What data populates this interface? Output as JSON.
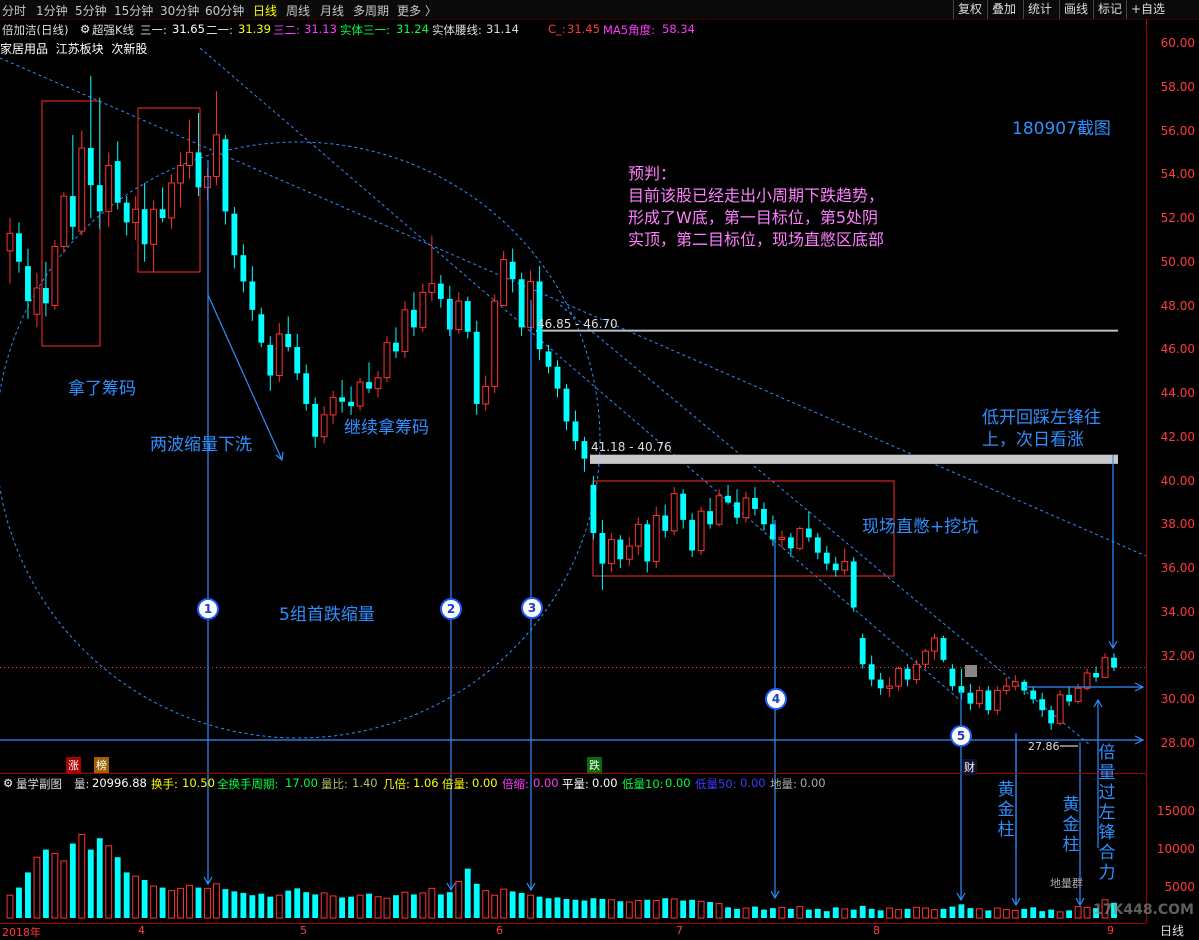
{
  "toolbar": {
    "left_items": [
      "分时",
      "1分钟",
      "5分钟",
      "15分钟",
      "30分钟",
      "60分钟",
      "日线",
      "周线",
      "月线",
      "多周期",
      "更多 〉"
    ],
    "active_item": "日线",
    "right_items": [
      "复权",
      "叠加",
      "统计",
      "画线",
      "标记",
      "+自选"
    ]
  },
  "info": {
    "stock": "倍加洁(日线)",
    "indicator_name": "超强K线",
    "s1_label": "三一:",
    "s1_value": "31.65",
    "s2_label": "二一:",
    "s2_value": "31.39",
    "s3_label": "三二:",
    "s3_value": "31.13",
    "s4_label": "实体三一:",
    "s4_value": "31.24",
    "s5_label": "实体腰线:",
    "s5_value": "31.14",
    "c_label": "C_:",
    "c_value": "31.45",
    "ma_label": "MA5角度:",
    "ma_value": "58.34"
  },
  "tags": [
    "家居用品",
    "江苏板块",
    "次新股"
  ],
  "y_ticks": [
    "60.00",
    "58.00",
    "56.00",
    "54.00",
    "52.00",
    "50.00",
    "48.00",
    "46.00",
    "44.00",
    "42.00",
    "40.00",
    "38.00",
    "36.00",
    "34.00",
    "32.00",
    "30.00",
    "28.00"
  ],
  "vol_ticks": [
    "15000",
    "10000",
    "5000"
  ],
  "x_ticks": [
    "2018年",
    "4",
    "5",
    "6",
    "7",
    "8",
    "9"
  ],
  "x_axis_right": "日线",
  "vol_info": {
    "title": "量学副图",
    "l1": "量:",
    "v1": "20996.88",
    "l2": "换手:",
    "v2": "10.50",
    "l3": "全换手周期:",
    "v3": "17.00",
    "l4": "量比:",
    "v4": "1.40",
    "l5": "几倍:",
    "v5": "1.06",
    "l6": "倍量:",
    "v6": "0.00",
    "l7": "倍缩:",
    "v7": "0.00",
    "l8": "平量:",
    "v8": "0.00",
    "l9": "低量10:",
    "v9": "0.00",
    "l10": "低量50:",
    "v10": "0.00",
    "l11": "地量:",
    "v11": "0.00"
  },
  "annotations": {
    "snapshot": "180907截图",
    "forecast": [
      "预判：",
      "目前该股已经走出小周期下跌趋势，",
      "形成了W底，第一目标位，第5处阴",
      "实顶，第二目标位，现场直憋区底部"
    ],
    "take_chips": "拿了筹码",
    "two_waves": "两波缩量下洗",
    "continue_chips": "继续拿筹码",
    "five_groups": "5组首跌缩量",
    "live_zone": "现场直憋+挖坑",
    "low_open": [
      "低开回踩左锋往",
      "上，次日看涨"
    ],
    "level1": "46.85 - 46.70",
    "level2": "41.18 - 40.76",
    "low_price": "27.86",
    "gold_bar": "黄金柱",
    "double_vol": "倍量过左锋合力",
    "ground_group": "地量群",
    "cai": "财",
    "zhang": "涨",
    "bang": "榜",
    "die": "跌",
    "nums": [
      "1",
      "2",
      "3",
      "4",
      "5"
    ],
    "watermark": "17K448.COM"
  },
  "colors": {
    "up": "#ff3232",
    "down": "#00ffff",
    "blue": "#2f8fff",
    "pink": "#ff7fff"
  },
  "chart_data": {
    "type": "candlestick",
    "ylim": [
      27,
      61
    ],
    "price_levels": [
      46.85,
      46.7,
      41.18,
      40.76
    ],
    "dates_shown": [
      "2018年",
      "4",
      "5",
      "6",
      "7",
      "8",
      "9"
    ],
    "ohlc_approx": [
      [
        50.5,
        52.0,
        49.0,
        51.3
      ],
      [
        51.3,
        51.8,
        49.5,
        50.0
      ],
      [
        49.8,
        50.6,
        47.4,
        48.2
      ],
      [
        47.6,
        49.5,
        47.0,
        48.8
      ],
      [
        48.8,
        50.0,
        47.5,
        48.1
      ],
      [
        48.0,
        51.0,
        47.8,
        50.7
      ],
      [
        50.7,
        53.2,
        50.4,
        53.0
      ],
      [
        53.0,
        55.8,
        51.0,
        51.6
      ],
      [
        51.4,
        56.0,
        51.2,
        55.2
      ],
      [
        55.2,
        58.5,
        52.0,
        53.5
      ],
      [
        53.5,
        57.5,
        51.5,
        52.3
      ],
      [
        52.3,
        55.0,
        51.6,
        54.4
      ],
      [
        54.6,
        55.5,
        52.4,
        52.7
      ],
      [
        52.7,
        53.0,
        51.2,
        51.8
      ],
      [
        51.8,
        53.0,
        51.0,
        52.4
      ],
      [
        52.4,
        53.6,
        50.0,
        50.8
      ],
      [
        50.8,
        52.8,
        49.5,
        52.4
      ],
      [
        52.4,
        53.4,
        51.8,
        52.0
      ],
      [
        52.0,
        54.0,
        51.5,
        53.6
      ],
      [
        53.6,
        55.0,
        52.5,
        54.4
      ],
      [
        54.4,
        56.5,
        53.8,
        55.0
      ],
      [
        55.0,
        56.8,
        53.0,
        53.4
      ],
      [
        53.4,
        54.3,
        52.8,
        53.9
      ],
      [
        53.9,
        57.8,
        53.5,
        55.8
      ],
      [
        55.6,
        55.8,
        51.7,
        52.3
      ],
      [
        52.2,
        52.5,
        49.7,
        50.3
      ],
      [
        50.3,
        50.8,
        48.6,
        49.1
      ],
      [
        49.1,
        49.8,
        47.3,
        47.8
      ],
      [
        47.6,
        47.9,
        46.1,
        46.3
      ],
      [
        46.2,
        46.6,
        44.1,
        44.8
      ],
      [
        44.8,
        47.2,
        44.5,
        46.7
      ],
      [
        46.7,
        47.5,
        45.9,
        46.1
      ],
      [
        46.1,
        46.7,
        44.6,
        44.9
      ],
      [
        44.9,
        45.3,
        43.2,
        43.5
      ],
      [
        43.5,
        43.8,
        41.5,
        42.0
      ],
      [
        42.0,
        43.4,
        41.7,
        43.0
      ],
      [
        43.0,
        44.1,
        42.6,
        43.8
      ],
      [
        43.8,
        44.6,
        43.1,
        43.6
      ],
      [
        43.6,
        44.3,
        43.0,
        43.4
      ],
      [
        43.4,
        44.7,
        43.2,
        44.5
      ],
      [
        44.5,
        45.4,
        44.0,
        44.2
      ],
      [
        44.2,
        45.0,
        43.8,
        44.7
      ],
      [
        44.7,
        46.6,
        44.5,
        46.3
      ],
      [
        46.3,
        47.0,
        45.6,
        45.9
      ],
      [
        45.9,
        48.2,
        45.6,
        47.8
      ],
      [
        47.8,
        48.6,
        46.6,
        47.0
      ],
      [
        47.0,
        49.0,
        46.8,
        48.6
      ],
      [
        48.6,
        51.2,
        48.2,
        49.0
      ],
      [
        49.0,
        49.4,
        47.9,
        48.3
      ],
      [
        48.3,
        48.9,
        46.6,
        46.9
      ],
      [
        46.9,
        48.6,
        46.7,
        48.2
      ],
      [
        48.2,
        48.4,
        46.5,
        46.8
      ],
      [
        46.8,
        47.3,
        43.0,
        43.5
      ],
      [
        43.5,
        44.8,
        43.2,
        44.3
      ],
      [
        44.3,
        48.5,
        44.0,
        48.2
      ],
      [
        48.0,
        50.5,
        48.0,
        50.1
      ],
      [
        50.0,
        50.6,
        48.6,
        49.2
      ],
      [
        49.2,
        49.5,
        46.6,
        47.0
      ],
      [
        47.0,
        49.6,
        46.8,
        49.1
      ],
      [
        49.1,
        49.8,
        45.5,
        46.0
      ],
      [
        45.9,
        46.2,
        44.9,
        45.2
      ],
      [
        45.2,
        45.5,
        43.8,
        44.2
      ],
      [
        44.2,
        44.4,
        42.3,
        42.7
      ],
      [
        42.7,
        43.2,
        41.4,
        41.8
      ],
      [
        41.8,
        42.0,
        40.4,
        41.0
      ],
      [
        39.8,
        40.2,
        37.3,
        37.6
      ],
      [
        37.6,
        38.2,
        35.0,
        36.2
      ],
      [
        36.2,
        37.6,
        35.8,
        37.3
      ],
      [
        37.3,
        37.5,
        36.0,
        36.4
      ],
      [
        36.4,
        37.4,
        36.1,
        37.0
      ],
      [
        37.0,
        38.3,
        36.6,
        38.0
      ],
      [
        38.0,
        38.2,
        35.8,
        36.3
      ],
      [
        36.3,
        38.8,
        36.0,
        38.4
      ],
      [
        38.4,
        38.9,
        37.4,
        37.7
      ],
      [
        37.7,
        39.7,
        37.5,
        39.4
      ],
      [
        39.4,
        39.6,
        37.8,
        38.2
      ],
      [
        38.2,
        38.5,
        36.5,
        36.8
      ],
      [
        36.8,
        38.8,
        36.6,
        38.6
      ],
      [
        38.6,
        39.2,
        37.8,
        38.0
      ],
      [
        38.0,
        39.6,
        37.9,
        39.3
      ],
      [
        39.3,
        39.8,
        38.9,
        39.0
      ],
      [
        39.0,
        39.6,
        38.0,
        38.3
      ],
      [
        38.3,
        39.5,
        38.1,
        39.2
      ],
      [
        39.2,
        39.7,
        38.4,
        38.7
      ],
      [
        38.7,
        39.0,
        37.7,
        38.0
      ],
      [
        38.0,
        38.4,
        37.0,
        37.3
      ],
      [
        37.3,
        37.7,
        36.9,
        37.4
      ],
      [
        37.4,
        37.6,
        36.5,
        36.9
      ],
      [
        36.9,
        37.9,
        36.8,
        37.8
      ],
      [
        37.8,
        38.6,
        37.2,
        37.4
      ],
      [
        37.4,
        37.6,
        36.4,
        36.7
      ],
      [
        36.7,
        37.0,
        35.9,
        36.2
      ],
      [
        36.2,
        36.5,
        35.6,
        35.9
      ],
      [
        35.9,
        36.9,
        35.7,
        36.3
      ],
      [
        36.3,
        36.5,
        34.0,
        34.2
      ],
      [
        32.8,
        33.0,
        31.4,
        31.6
      ],
      [
        31.6,
        32.0,
        30.6,
        30.9
      ],
      [
        30.9,
        31.2,
        30.2,
        30.5
      ],
      [
        30.5,
        31.0,
        30.1,
        30.6
      ],
      [
        30.6,
        31.5,
        30.4,
        31.4
      ],
      [
        31.4,
        31.6,
        30.6,
        30.9
      ],
      [
        30.9,
        31.8,
        30.7,
        31.6
      ],
      [
        31.6,
        32.3,
        31.4,
        32.2
      ],
      [
        32.2,
        33.0,
        31.8,
        32.8
      ],
      [
        32.8,
        32.9,
        31.7,
        31.8
      ],
      [
        31.4,
        31.6,
        30.4,
        30.6
      ],
      [
        30.6,
        31.4,
        30.0,
        30.3
      ],
      [
        30.3,
        30.7,
        29.5,
        29.8
      ],
      [
        29.8,
        30.6,
        29.6,
        30.4
      ],
      [
        30.4,
        30.6,
        29.3,
        29.5
      ],
      [
        29.5,
        30.6,
        29.3,
        30.4
      ],
      [
        30.4,
        31.0,
        30.2,
        30.6
      ],
      [
        30.6,
        31.1,
        30.4,
        30.8
      ],
      [
        30.8,
        30.9,
        30.2,
        30.4
      ],
      [
        30.4,
        30.6,
        29.8,
        30.0
      ],
      [
        30.0,
        30.3,
        29.2,
        29.5
      ],
      [
        29.5,
        29.7,
        28.6,
        28.9
      ],
      [
        28.9,
        30.4,
        28.8,
        30.2
      ],
      [
        30.2,
        30.6,
        29.7,
        29.9
      ],
      [
        29.9,
        30.7,
        29.8,
        30.5
      ],
      [
        30.5,
        31.4,
        30.4,
        31.2
      ],
      [
        31.2,
        31.5,
        30.8,
        31.0
      ],
      [
        31.0,
        32.1,
        31.0,
        31.9
      ],
      [
        31.9,
        32.1,
        31.3,
        31.45
      ]
    ],
    "volume_approx": [
      3000,
      4000,
      6000,
      8000,
      9000,
      8500,
      7500,
      9800,
      11000,
      9000,
      10500,
      9500,
      8000,
      6000,
      5500,
      5000,
      4200,
      4000,
      3600,
      3900,
      4300,
      4000,
      3900,
      4500,
      3800,
      3500,
      3300,
      3000,
      3200,
      2800,
      3000,
      3600,
      3900,
      3400,
      3100,
      3300,
      2900,
      2700,
      2800,
      3000,
      3200,
      2800,
      2600,
      3000,
      3400,
      3100,
      3300,
      3900,
      3100,
      3400,
      4800,
      6500,
      4500,
      3600,
      3000,
      3800,
      3500,
      3300,
      3000,
      2800,
      2600,
      2700,
      2500,
      2400,
      2300,
      2600,
      2500,
      2400,
      2200,
      2100,
      2300,
      2400,
      2300,
      2600,
      2500,
      2300,
      2400,
      2200,
      2100,
      1900,
      1400,
      1200,
      1300,
      1500,
      1100,
      1300,
      1400,
      1200,
      1500,
      1100,
      1200,
      900,
      1400,
      1200,
      1100,
      1600,
      1200,
      1000,
      1300,
      1100,
      1200,
      1400,
      1300,
      1100,
      1200,
      1500,
      1800,
      1300,
      1200,
      1000,
      1300,
      1100,
      1000,
      1200,
      1400,
      900,
      1100,
      800,
      1000,
      1500,
      1400,
      1300,
      2400,
      2000
    ]
  }
}
